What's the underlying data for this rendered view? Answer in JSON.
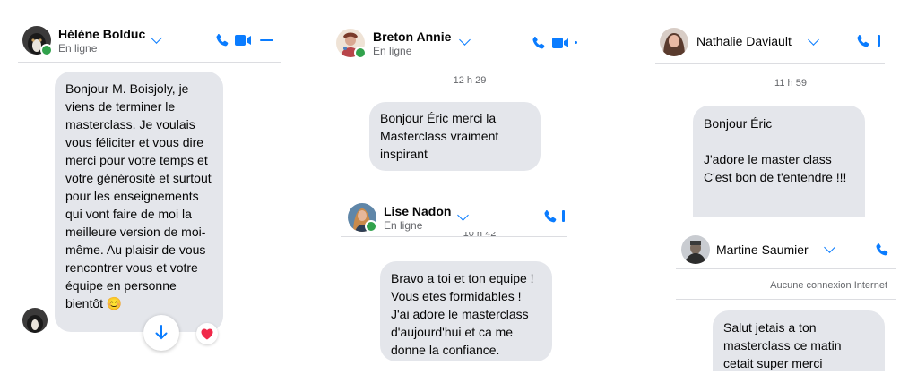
{
  "colors": {
    "accent": "#0a7cff",
    "bubble": "#e4e6eb",
    "online": "#31a24c",
    "heart": "#f02849"
  },
  "chats": [
    {
      "contact": "Hélène Bolduc",
      "status": "En ligne",
      "messages": [
        "Bonjour M. Boisjoly,  je viens de terminer le masterclass.  Je voulais vous féliciter et vous dire merci pour votre temps et votre générosité et surtout pour les enseignements qui vont faire de moi la meilleure version de moi-même. Au plaisir de vous rencontrer vous et votre équipe en personne bientôt 😊"
      ],
      "icons": [
        "phone-icon",
        "video-icon",
        "minimize-icon",
        "scroll-down-icon",
        "heart-icon"
      ]
    },
    {
      "contact": "Breton Annie",
      "status": "En ligne",
      "timestamp": "12 h 29",
      "messages": [
        "Bonjour Éric merci la Masterclass vraiment inspirant"
      ],
      "icons": [
        "phone-icon",
        "video-icon"
      ]
    },
    {
      "contact": "Lise Nadon",
      "status": "En ligne",
      "timestamp": "10 h 42",
      "messages": [
        "Bravo a toi et ton equipe ! Vous etes formidables ! J'ai adore le masterclass d'aujourd'hui et ca me donne la confiance."
      ],
      "icons": [
        "phone-icon"
      ]
    },
    {
      "contact": "Nathalie Daviault",
      "timestamp": "11 h 59",
      "messages": [
        "Bonjour Éric\n\nJ'adore le master class C'est bon de t'entendre !!!"
      ],
      "icons": [
        "phone-icon"
      ]
    },
    {
      "contact": "Martine Saumier",
      "notice": "Aucune connexion Internet",
      "messages": [
        "Salut jetais a ton masterclass ce matin cetait super merci"
      ],
      "icons": [
        "phone-icon"
      ]
    }
  ]
}
